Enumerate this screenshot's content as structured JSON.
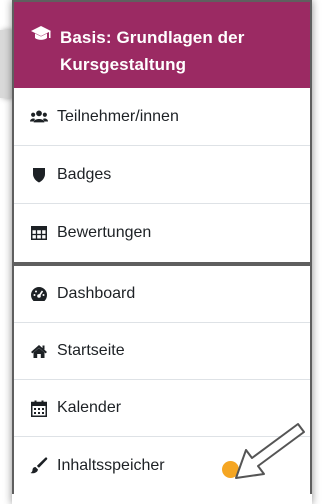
{
  "course": {
    "title": "Basis: Grundlagen der Kursgestaltung",
    "icon": "graduation-cap-icon"
  },
  "course_nav": {
    "items": [
      {
        "label": "Teilnehmer/innen",
        "icon": "users-icon"
      },
      {
        "label": "Badges",
        "icon": "shield-icon"
      },
      {
        "label": "Bewertungen",
        "icon": "table-icon"
      }
    ]
  },
  "site_nav": {
    "items": [
      {
        "label": "Dashboard",
        "icon": "tachometer-icon"
      },
      {
        "label": "Startseite",
        "icon": "home-icon"
      },
      {
        "label": "Kalender",
        "icon": "calendar-icon"
      },
      {
        "label": "Inhaltsspeicher",
        "icon": "paintbrush-icon"
      }
    ]
  },
  "colors": {
    "header_bg": "#9b2a63",
    "highlight_dot": "#f5a623"
  }
}
